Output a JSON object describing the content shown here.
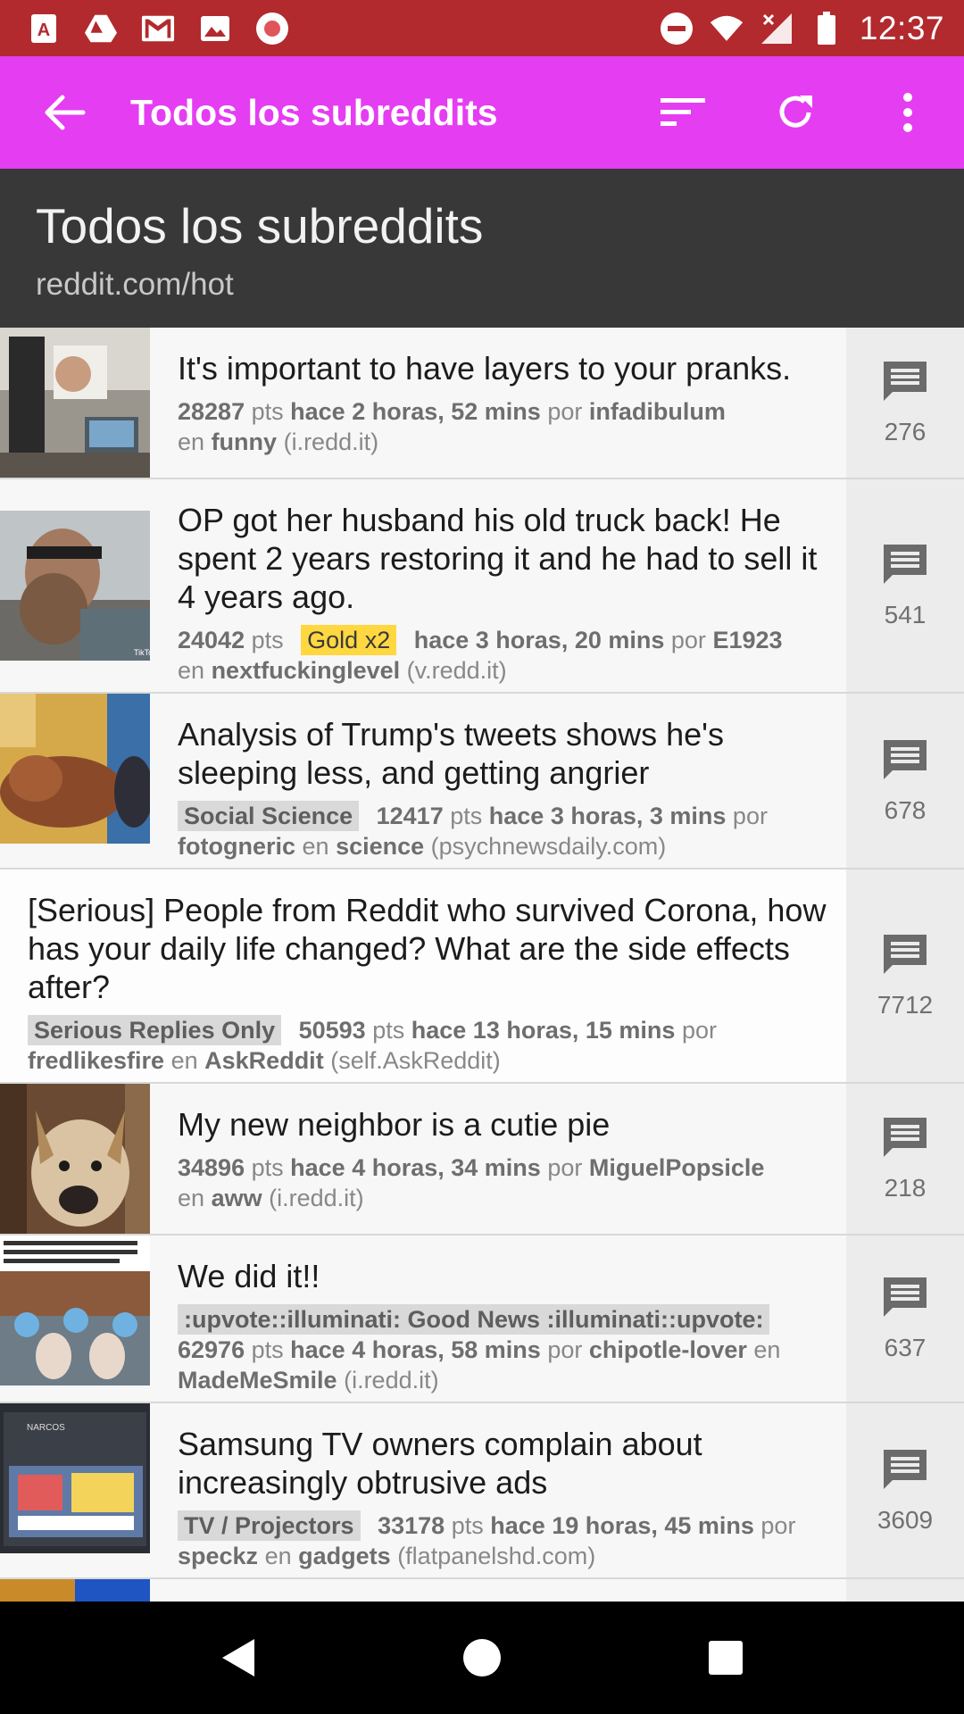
{
  "status_bar": {
    "time": "12:37",
    "icons": [
      "text-a-icon",
      "drive-icon",
      "gmail-icon",
      "photos-icon",
      "record-icon",
      "dnd-icon",
      "wifi-icon",
      "signal-icon",
      "battery-icon"
    ]
  },
  "app_bar": {
    "title": "Todos los subreddits",
    "colors": {
      "accent": "#e53df2",
      "status": "#b22a2e"
    }
  },
  "header": {
    "title": "Todos los subreddits",
    "subtitle": "reddit.com/hot"
  },
  "posts": [
    {
      "title": "It's important to have layers to your pranks.",
      "points": "28287",
      "pts_label": "pts",
      "time": "hace 2 horas, 52 mins",
      "by_label": "por",
      "author": "infadibulum",
      "in_label": "en",
      "subreddit": "funny",
      "domain": "(i.redd.it)",
      "comments": "276"
    },
    {
      "title": "OP got her husband his old truck back! He spent 2 years restoring it and he had to sell it 4 years ago.",
      "points": "24042",
      "pts_label": "pts",
      "gold": "Gold x2",
      "time": "hace 3 horas, 20 mins",
      "by_label": "por",
      "author": "E1923",
      "in_label": "en",
      "subreddit": "nextfuckinglevel",
      "domain": "(v.redd.it)",
      "comments": "541"
    },
    {
      "title": "Analysis of Trump's tweets shows he's sleeping less, and getting angrier",
      "flair": "Social Science",
      "points": "12417",
      "pts_label": "pts",
      "time": "hace 3 horas, 3 mins",
      "by_label": "por",
      "author": "fotogneric",
      "in_label": "en",
      "subreddit": "science",
      "domain": "(psychnewsdaily.com)",
      "comments": "678"
    },
    {
      "title": "[Serious] People from Reddit who survived Corona, how has your daily life changed? What are the side effects after?",
      "flair": "Serious Replies Only",
      "points": "50593",
      "pts_label": "pts",
      "time": "hace 13 horas, 15 mins",
      "by_label": "por",
      "author": "fredlikesfire",
      "in_label": "en",
      "subreddit": "AskReddit",
      "domain": "(self.AskReddit)",
      "comments": "7712"
    },
    {
      "title": "My new neighbor is a cutie pie",
      "points": "34896",
      "pts_label": "pts",
      "time": "hace 4 horas, 34 mins",
      "by_label": "por",
      "author": "MiguelPopsicle",
      "in_label": "en",
      "subreddit": "aww",
      "domain": "(i.redd.it)",
      "comments": "218"
    },
    {
      "title": "We did it!!",
      "flair": ":upvote::illuminati: Good News :illuminati::upvote:",
      "points": "62976",
      "pts_label": "pts",
      "time": "hace 4 horas, 58 mins",
      "by_label": "por",
      "author": "chipotle-lover",
      "in_label": "en",
      "subreddit": "MadeMeSmile",
      "domain": "(i.redd.it)",
      "comments": "637"
    },
    {
      "title": "Samsung TV owners complain about increasingly obtrusive ads",
      "flair": "TV / Projectors",
      "points": "33178",
      "pts_label": "pts",
      "time": "hace 19 horas, 45 mins",
      "by_label": "por",
      "author": "speckz",
      "in_label": "en",
      "subreddit": "gadgets",
      "domain": "(flatpanelshd.com)",
      "comments": "3609"
    }
  ]
}
